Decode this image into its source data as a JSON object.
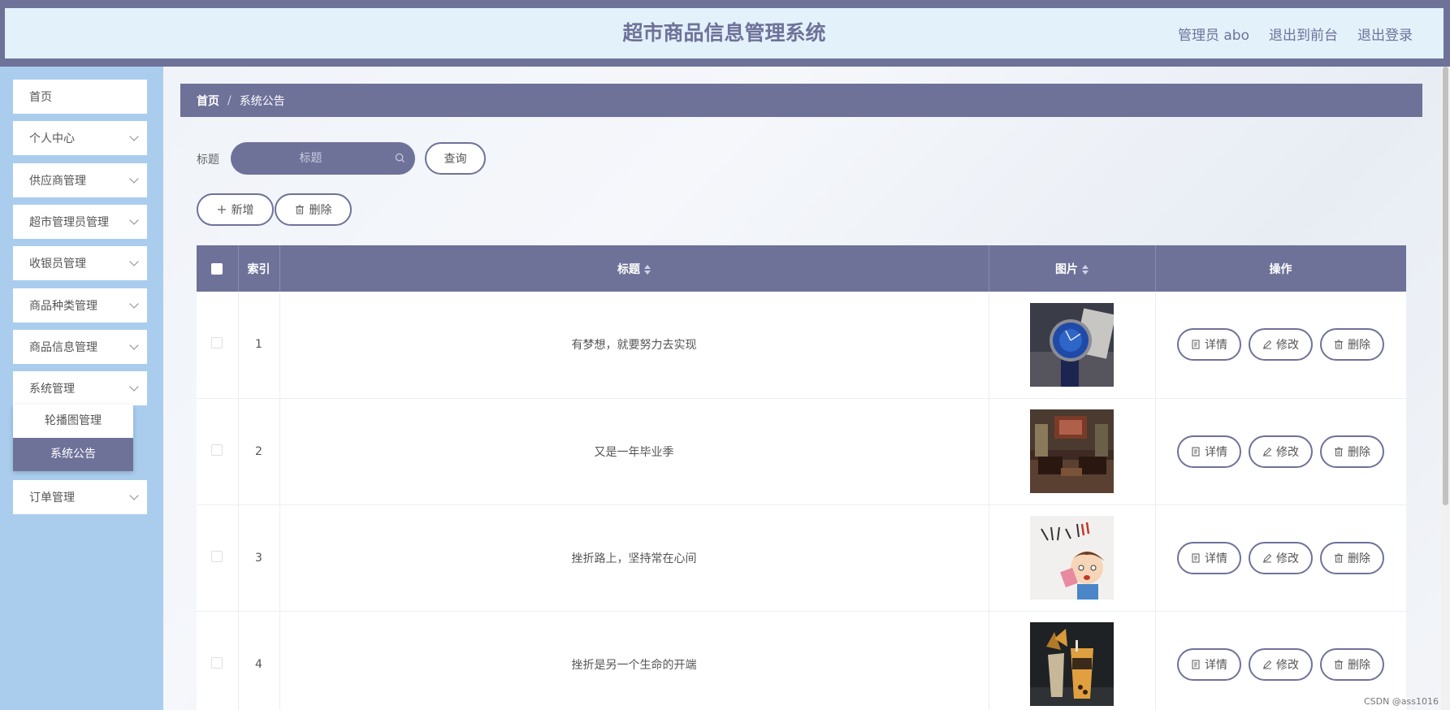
{
  "header": {
    "title": "超市商品信息管理系统",
    "admin_label": "管理员 abo",
    "to_front": "退出到前台",
    "logout": "退出登录"
  },
  "sidebar": {
    "items": [
      {
        "label": "首页",
        "has_arrow": false
      },
      {
        "label": "个人中心",
        "has_arrow": true
      },
      {
        "label": "供应商管理",
        "has_arrow": true
      },
      {
        "label": "超市管理员管理",
        "has_arrow": true
      },
      {
        "label": "收银员管理",
        "has_arrow": true
      },
      {
        "label": "商品种类管理",
        "has_arrow": true
      },
      {
        "label": "商品信息管理",
        "has_arrow": true
      },
      {
        "label": "系统管理",
        "has_arrow": true
      },
      {
        "label": "订单管理",
        "has_arrow": true
      }
    ],
    "submenu": [
      {
        "label": "轮播图管理",
        "active": false
      },
      {
        "label": "系统公告",
        "active": true
      }
    ]
  },
  "breadcrumb": {
    "home": "首页",
    "separator": "/",
    "current": "系统公告"
  },
  "search": {
    "label": "标题",
    "placeholder": "标题",
    "button": "查询"
  },
  "toolbar": {
    "add": "新增",
    "delete": "删除"
  },
  "table": {
    "columns": [
      "索引",
      "标题",
      "图片",
      "操作"
    ],
    "rows": [
      {
        "index": "1",
        "title": "有梦想，就要努力去实现",
        "image": "watch-photo"
      },
      {
        "index": "2",
        "title": "又是一年毕业季",
        "image": "interior-photo"
      },
      {
        "index": "3",
        "title": "挫折路上，坚持常在心间",
        "image": "cartoon-photo"
      },
      {
        "index": "4",
        "title": "挫折是另一个生命的开端",
        "image": "drinks-photo"
      }
    ],
    "actions": {
      "detail": "详情",
      "edit": "修改",
      "delete": "删除"
    }
  },
  "watermark": "CSDN @ass1016",
  "colors": {
    "primary": "#6e7299",
    "sidebar": "#aacdee",
    "header_bg": "#e3f1fb"
  }
}
